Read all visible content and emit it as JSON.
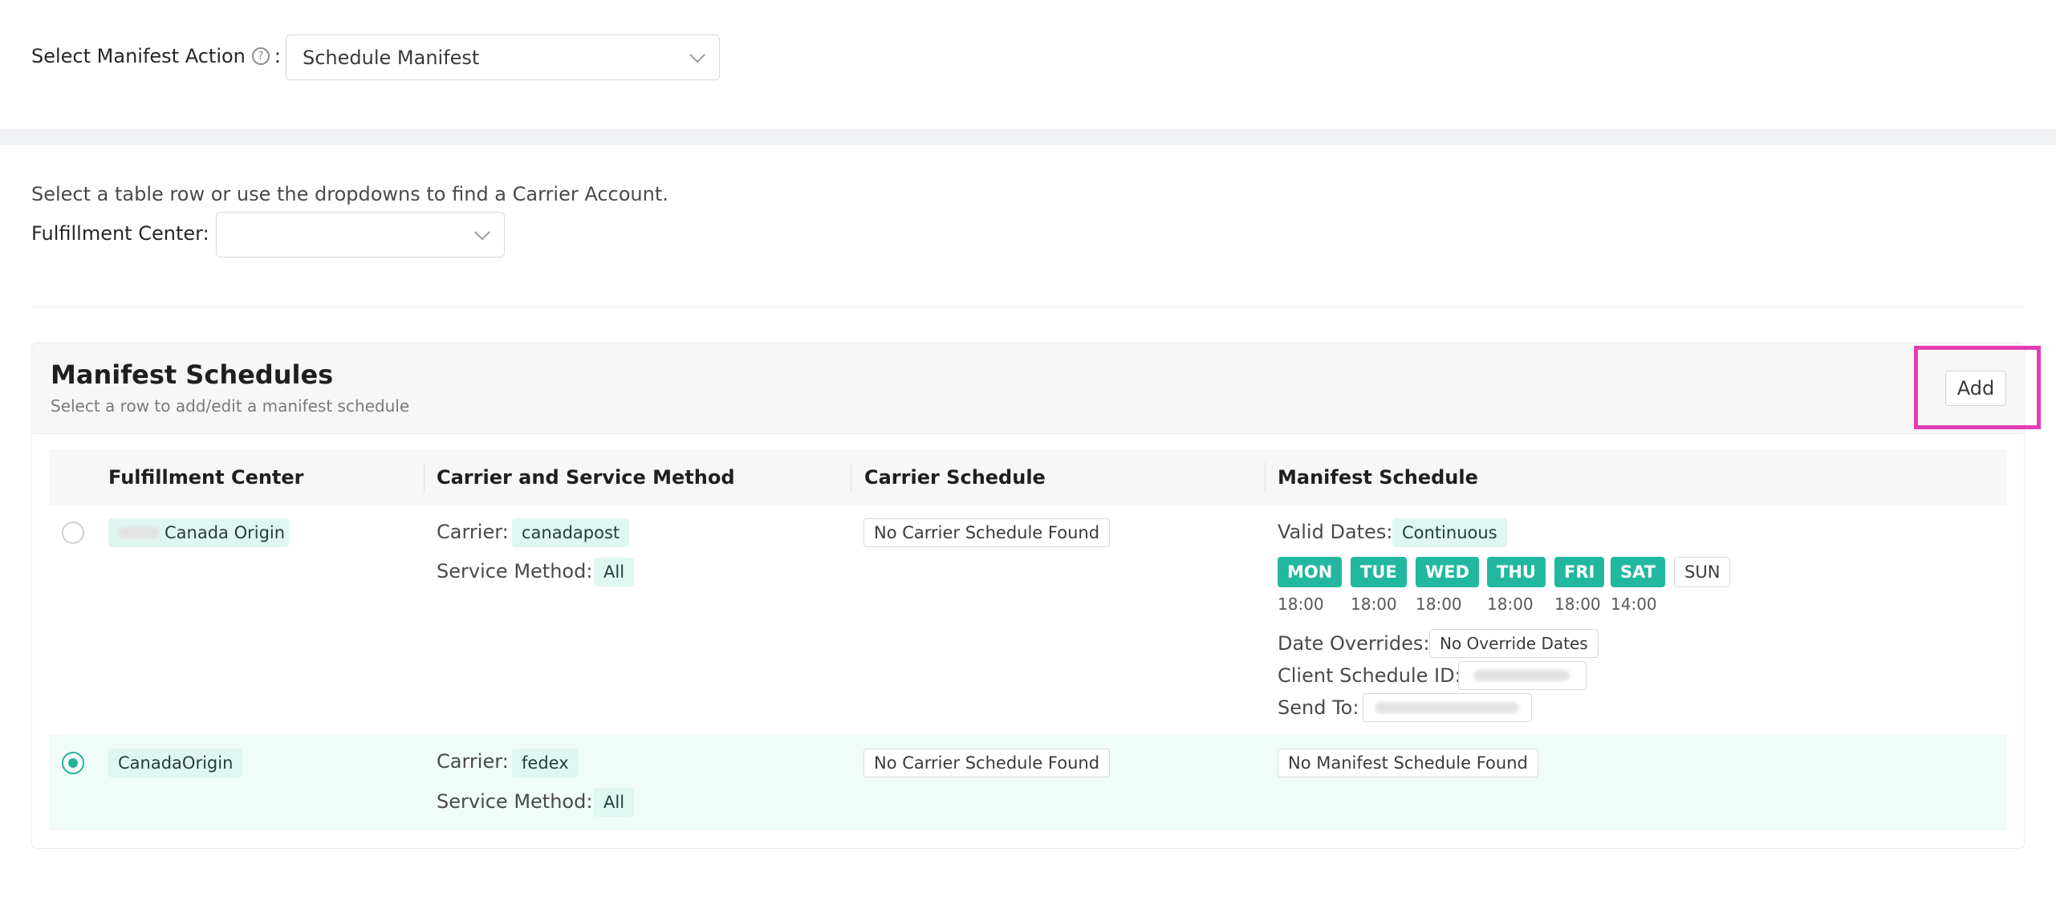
{
  "manifest_action": {
    "label": "Select Manifest Action",
    "help_icon": "question-circle-icon",
    "colon": ":",
    "value": "Schedule Manifest"
  },
  "hint": "Select a table row or use the dropdowns to find a Carrier Account.",
  "fulfillment_filter": {
    "label": "Fulfillment Center",
    "colon": ":",
    "value": ""
  },
  "card": {
    "title": "Manifest Schedules",
    "subtitle": "Select a row to add/edit a manifest schedule",
    "add_label": "Add"
  },
  "columns": [
    "Fulfillment Center",
    "Carrier and Service Method",
    "Carrier Schedule",
    "Manifest Schedule"
  ],
  "labels": {
    "carrier": "Carrier:",
    "service_method": "Service Method:",
    "valid_dates": "Valid Dates:",
    "date_overrides": "Date Overrides:",
    "client_schedule_id": "Client Schedule ID:",
    "send_to": "Send To:"
  },
  "rows": [
    {
      "selected": false,
      "fulfillment_center": "Canada Origin",
      "carrier": "canadapost",
      "service_method": "All",
      "carrier_schedule": "No Carrier Schedule Found",
      "valid_dates": "Continuous",
      "days": [
        {
          "day": "MON",
          "active": true,
          "time": "18:00"
        },
        {
          "day": "TUE",
          "active": true,
          "time": "18:00"
        },
        {
          "day": "WED",
          "active": true,
          "time": "18:00"
        },
        {
          "day": "THU",
          "active": true,
          "time": "18:00"
        },
        {
          "day": "FRI",
          "active": true,
          "time": "18:00"
        },
        {
          "day": "SAT",
          "active": true,
          "time": "14:00"
        },
        {
          "day": "SUN",
          "active": false,
          "time": ""
        }
      ],
      "date_overrides": "No Override Dates"
    },
    {
      "selected": true,
      "fulfillment_center": "CanadaOrigin",
      "carrier": "fedex",
      "service_method": "All",
      "carrier_schedule": "No Carrier Schedule Found",
      "manifest_schedule": "No Manifest Schedule Found"
    }
  ],
  "colors": {
    "accent": "#22b8a0",
    "highlight": "#e23db4",
    "selected_row": "#effcf7"
  }
}
